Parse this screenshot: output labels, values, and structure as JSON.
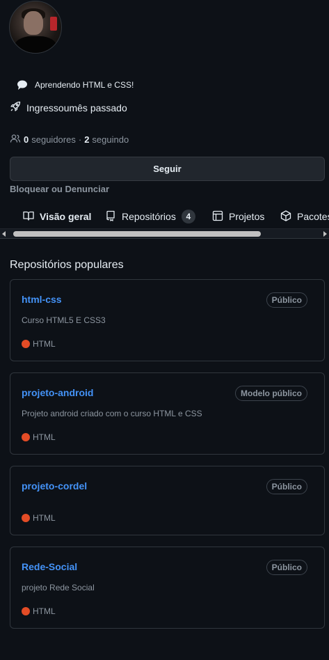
{
  "profile": {
    "status_text": "Aprendendo HTML e CSS!",
    "joined_text": "Ingressoumês passado",
    "followers_count": "0",
    "followers_label": "seguidores",
    "separator": "·",
    "following_count": "2",
    "following_label": "seguindo",
    "follow_button": "Seguir",
    "block_link": "Bloquear ou Denunciar"
  },
  "tabs": [
    {
      "label": "Visão geral",
      "icon": "book-icon",
      "active": true
    },
    {
      "label": "Repositórios",
      "icon": "repo-icon",
      "count": "4"
    },
    {
      "label": "Projetos",
      "icon": "table-icon"
    },
    {
      "label": "Pacotes",
      "icon": "package-icon"
    }
  ],
  "popular": {
    "title": "Repositórios populares",
    "repos": [
      {
        "name": "html-css",
        "visibility": "Público",
        "description": "Curso HTML5 E CSS3",
        "language": "HTML"
      },
      {
        "name": "projeto-android",
        "visibility": "Modelo público",
        "description": "Projeto android criado com o curso HTML e CSS",
        "language": "HTML"
      },
      {
        "name": "projeto-cordel",
        "visibility": "Público",
        "description": "",
        "language": "HTML"
      },
      {
        "name": "Rede-Social",
        "visibility": "Público",
        "description": "projeto Rede Social",
        "language": "HTML"
      }
    ]
  },
  "colors": {
    "background": "#0d1117",
    "link": "#4493f8",
    "html_lang": "#e34c26",
    "muted": "#8d96a0"
  }
}
